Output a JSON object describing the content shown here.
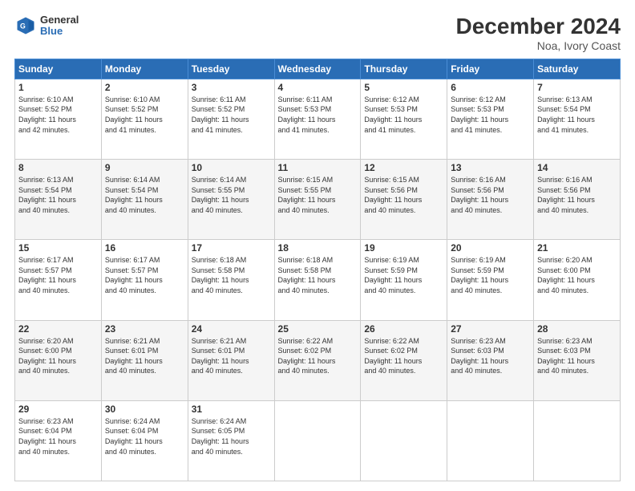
{
  "header": {
    "logo_line1": "General",
    "logo_line2": "Blue",
    "title": "December 2024",
    "subtitle": "Noa, Ivory Coast"
  },
  "calendar": {
    "weekdays": [
      "Sunday",
      "Monday",
      "Tuesday",
      "Wednesday",
      "Thursday",
      "Friday",
      "Saturday"
    ],
    "weeks": [
      [
        {
          "day": "1",
          "info": "Sunrise: 6:10 AM\nSunset: 5:52 PM\nDaylight: 11 hours\nand 42 minutes."
        },
        {
          "day": "2",
          "info": "Sunrise: 6:10 AM\nSunset: 5:52 PM\nDaylight: 11 hours\nand 41 minutes."
        },
        {
          "day": "3",
          "info": "Sunrise: 6:11 AM\nSunset: 5:52 PM\nDaylight: 11 hours\nand 41 minutes."
        },
        {
          "day": "4",
          "info": "Sunrise: 6:11 AM\nSunset: 5:53 PM\nDaylight: 11 hours\nand 41 minutes."
        },
        {
          "day": "5",
          "info": "Sunrise: 6:12 AM\nSunset: 5:53 PM\nDaylight: 11 hours\nand 41 minutes."
        },
        {
          "day": "6",
          "info": "Sunrise: 6:12 AM\nSunset: 5:53 PM\nDaylight: 11 hours\nand 41 minutes."
        },
        {
          "day": "7",
          "info": "Sunrise: 6:13 AM\nSunset: 5:54 PM\nDaylight: 11 hours\nand 41 minutes."
        }
      ],
      [
        {
          "day": "8",
          "info": "Sunrise: 6:13 AM\nSunset: 5:54 PM\nDaylight: 11 hours\nand 40 minutes."
        },
        {
          "day": "9",
          "info": "Sunrise: 6:14 AM\nSunset: 5:54 PM\nDaylight: 11 hours\nand 40 minutes."
        },
        {
          "day": "10",
          "info": "Sunrise: 6:14 AM\nSunset: 5:55 PM\nDaylight: 11 hours\nand 40 minutes."
        },
        {
          "day": "11",
          "info": "Sunrise: 6:15 AM\nSunset: 5:55 PM\nDaylight: 11 hours\nand 40 minutes."
        },
        {
          "day": "12",
          "info": "Sunrise: 6:15 AM\nSunset: 5:56 PM\nDaylight: 11 hours\nand 40 minutes."
        },
        {
          "day": "13",
          "info": "Sunrise: 6:16 AM\nSunset: 5:56 PM\nDaylight: 11 hours\nand 40 minutes."
        },
        {
          "day": "14",
          "info": "Sunrise: 6:16 AM\nSunset: 5:56 PM\nDaylight: 11 hours\nand 40 minutes."
        }
      ],
      [
        {
          "day": "15",
          "info": "Sunrise: 6:17 AM\nSunset: 5:57 PM\nDaylight: 11 hours\nand 40 minutes."
        },
        {
          "day": "16",
          "info": "Sunrise: 6:17 AM\nSunset: 5:57 PM\nDaylight: 11 hours\nand 40 minutes."
        },
        {
          "day": "17",
          "info": "Sunrise: 6:18 AM\nSunset: 5:58 PM\nDaylight: 11 hours\nand 40 minutes."
        },
        {
          "day": "18",
          "info": "Sunrise: 6:18 AM\nSunset: 5:58 PM\nDaylight: 11 hours\nand 40 minutes."
        },
        {
          "day": "19",
          "info": "Sunrise: 6:19 AM\nSunset: 5:59 PM\nDaylight: 11 hours\nand 40 minutes."
        },
        {
          "day": "20",
          "info": "Sunrise: 6:19 AM\nSunset: 5:59 PM\nDaylight: 11 hours\nand 40 minutes."
        },
        {
          "day": "21",
          "info": "Sunrise: 6:20 AM\nSunset: 6:00 PM\nDaylight: 11 hours\nand 40 minutes."
        }
      ],
      [
        {
          "day": "22",
          "info": "Sunrise: 6:20 AM\nSunset: 6:00 PM\nDaylight: 11 hours\nand 40 minutes."
        },
        {
          "day": "23",
          "info": "Sunrise: 6:21 AM\nSunset: 6:01 PM\nDaylight: 11 hours\nand 40 minutes."
        },
        {
          "day": "24",
          "info": "Sunrise: 6:21 AM\nSunset: 6:01 PM\nDaylight: 11 hours\nand 40 minutes."
        },
        {
          "day": "25",
          "info": "Sunrise: 6:22 AM\nSunset: 6:02 PM\nDaylight: 11 hours\nand 40 minutes."
        },
        {
          "day": "26",
          "info": "Sunrise: 6:22 AM\nSunset: 6:02 PM\nDaylight: 11 hours\nand 40 minutes."
        },
        {
          "day": "27",
          "info": "Sunrise: 6:23 AM\nSunset: 6:03 PM\nDaylight: 11 hours\nand 40 minutes."
        },
        {
          "day": "28",
          "info": "Sunrise: 6:23 AM\nSunset: 6:03 PM\nDaylight: 11 hours\nand 40 minutes."
        }
      ],
      [
        {
          "day": "29",
          "info": "Sunrise: 6:23 AM\nSunset: 6:04 PM\nDaylight: 11 hours\nand 40 minutes."
        },
        {
          "day": "30",
          "info": "Sunrise: 6:24 AM\nSunset: 6:04 PM\nDaylight: 11 hours\nand 40 minutes."
        },
        {
          "day": "31",
          "info": "Sunrise: 6:24 AM\nSunset: 6:05 PM\nDaylight: 11 hours\nand 40 minutes."
        },
        null,
        null,
        null,
        null
      ]
    ]
  }
}
